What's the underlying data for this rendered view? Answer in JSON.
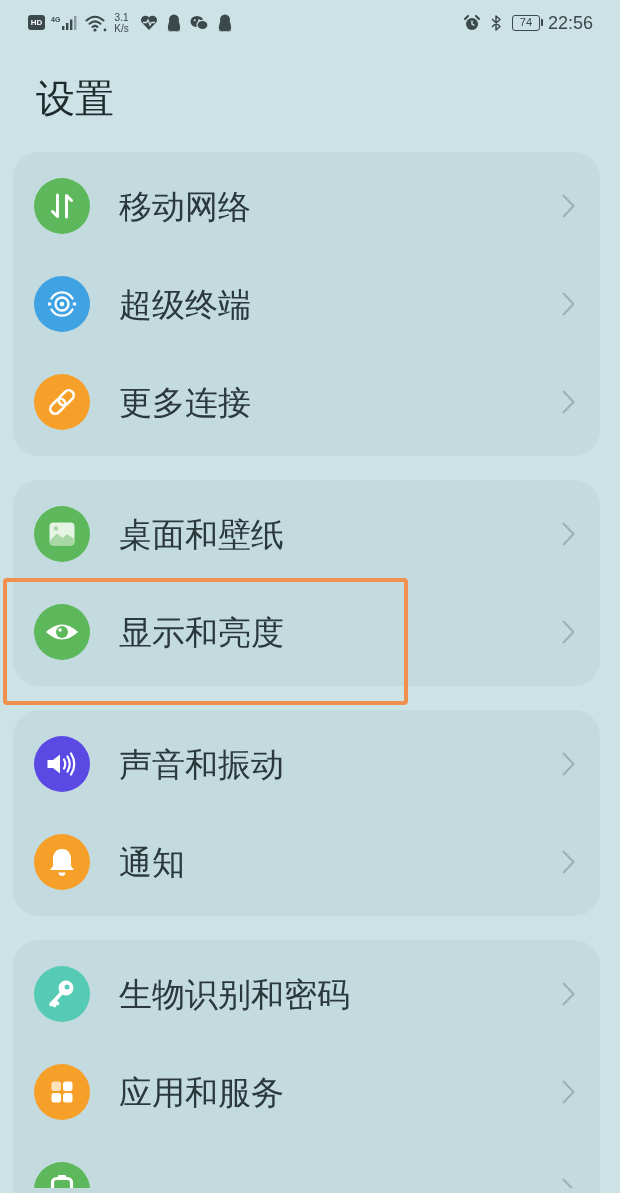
{
  "status_bar": {
    "hd_badge": "HD",
    "network_type": "4G",
    "speed_value": "3.1",
    "speed_unit": "K/s",
    "battery_percent": "74",
    "time": "22:56"
  },
  "title": "设置",
  "groups": [
    {
      "items": [
        {
          "label": "移动网络",
          "kind": "mobile-data",
          "color": "#5cb85a",
          "highlighted": false
        },
        {
          "label": "超级终端",
          "kind": "rings",
          "color": "#3fa2e3",
          "highlighted": false
        },
        {
          "label": "更多连接",
          "kind": "link",
          "color": "#f6a02a",
          "highlighted": false
        }
      ]
    },
    {
      "items": [
        {
          "label": "桌面和壁纸",
          "kind": "image",
          "color": "#5cb85a",
          "highlighted": false
        },
        {
          "label": "显示和亮度",
          "kind": "eye",
          "color": "#5cb85a",
          "highlighted": true
        }
      ]
    },
    {
      "items": [
        {
          "label": "声音和振动",
          "kind": "speaker",
          "color": "#5a4ae3",
          "highlighted": false
        },
        {
          "label": "通知",
          "kind": "bell",
          "color": "#f6a02a",
          "highlighted": false
        }
      ]
    },
    {
      "items": [
        {
          "label": "生物识别和密码",
          "kind": "key",
          "color": "#55cbb6",
          "highlighted": false
        },
        {
          "label": "应用和服务",
          "kind": "grid",
          "color": "#f6a02a",
          "highlighted": false
        },
        {
          "kind": "battery",
          "color": "#5cb85a",
          "highlighted": false
        }
      ]
    }
  ]
}
